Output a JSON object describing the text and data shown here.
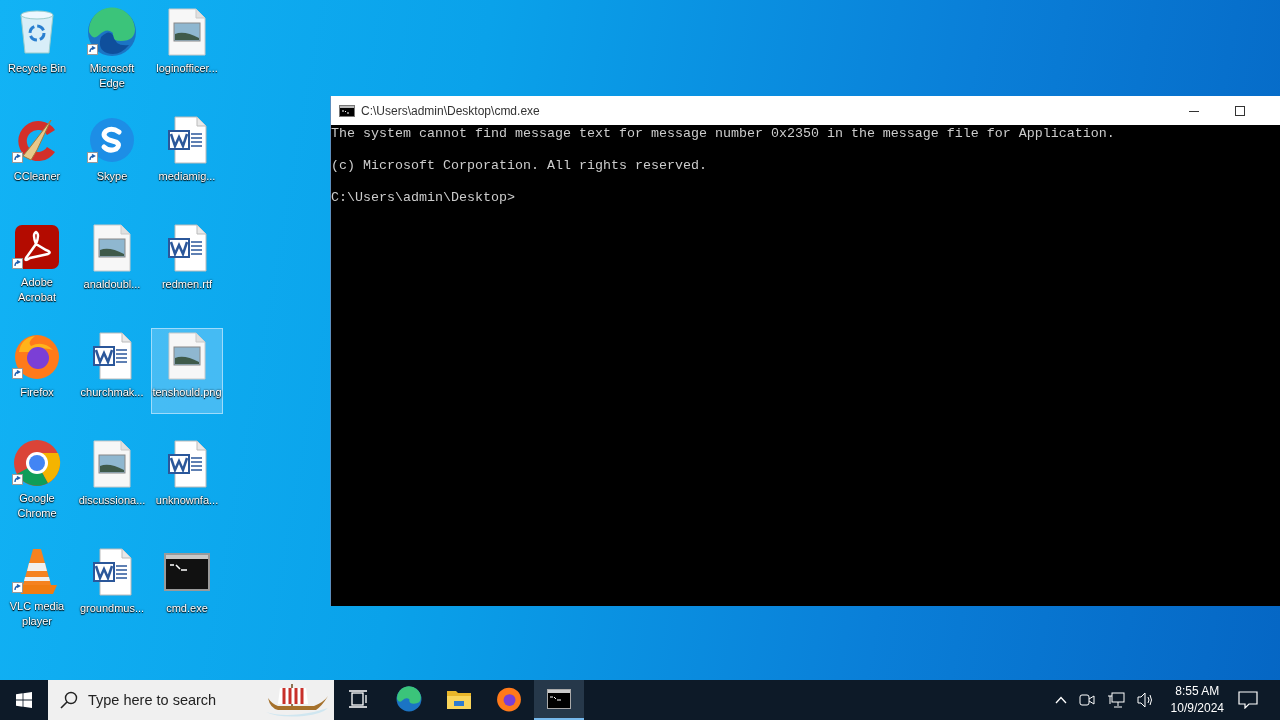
{
  "desktop_icons": [
    {
      "label": "Recycle Bin",
      "kind": "recycle-bin",
      "shortcut": false,
      "selected": false
    },
    {
      "label": "Microsoft Edge",
      "kind": "edge",
      "shortcut": true,
      "selected": false
    },
    {
      "label": "loginofficer...",
      "kind": "image",
      "shortcut": false,
      "selected": false
    },
    {
      "label": "CCleaner",
      "kind": "ccleaner",
      "shortcut": true,
      "selected": false
    },
    {
      "label": "Skype",
      "kind": "skype",
      "shortcut": true,
      "selected": false
    },
    {
      "label": "mediamig...",
      "kind": "word",
      "shortcut": false,
      "selected": false
    },
    {
      "label": "Adobe Acrobat",
      "kind": "acrobat",
      "shortcut": true,
      "selected": false
    },
    {
      "label": "analdoubl...",
      "kind": "image",
      "shortcut": false,
      "selected": false
    },
    {
      "label": "redmen.rtf",
      "kind": "word",
      "shortcut": false,
      "selected": false
    },
    {
      "label": "Firefox",
      "kind": "firefox",
      "shortcut": true,
      "selected": false
    },
    {
      "label": "churchmak...",
      "kind": "word",
      "shortcut": false,
      "selected": false
    },
    {
      "label": "tenshould.png",
      "kind": "image",
      "shortcut": false,
      "selected": true
    },
    {
      "label": "Google Chrome",
      "kind": "chrome",
      "shortcut": true,
      "selected": false
    },
    {
      "label": "discussiona...",
      "kind": "image",
      "shortcut": false,
      "selected": false
    },
    {
      "label": "unknownfa...",
      "kind": "word",
      "shortcut": false,
      "selected": false
    },
    {
      "label": "VLC media player",
      "kind": "vlc",
      "shortcut": true,
      "selected": false
    },
    {
      "label": "groundmus...",
      "kind": "word",
      "shortcut": false,
      "selected": false
    },
    {
      "label": "cmd.exe",
      "kind": "cmd",
      "shortcut": false,
      "selected": false
    }
  ],
  "console_window": {
    "title": "C:\\Users\\admin\\Desktop\\cmd.exe",
    "lines": [
      "The system cannot find message text for message number 0x2350 in the message file for Application.",
      "(c) Microsoft Corporation. All rights reserved.",
      "C:\\Users\\admin\\Desktop>"
    ]
  },
  "taskbar": {
    "search": {
      "placeholder": "Type here to search"
    },
    "apps": [
      {
        "kind": "task-view",
        "active": false
      },
      {
        "kind": "edge",
        "active": false
      },
      {
        "kind": "explorer",
        "active": false
      },
      {
        "kind": "firefox",
        "active": false
      },
      {
        "kind": "cmd",
        "active": true
      }
    ],
    "clock": {
      "time": "8:55 AM",
      "date": "10/9/2024"
    }
  }
}
